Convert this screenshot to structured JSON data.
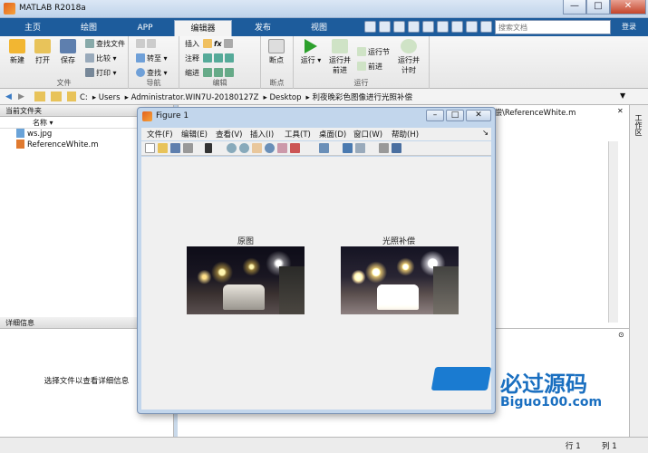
{
  "window": {
    "title": "MATLAB R2018a",
    "minimize": "—",
    "maximize": "□",
    "close": "✕"
  },
  "tabs": [
    "主页",
    "绘图",
    "APP",
    "编辑器",
    "发布",
    "视图"
  ],
  "active_tab": "编辑器",
  "search": {
    "placeholder": "搜索文档"
  },
  "login": "登录",
  "ribbon": {
    "file": {
      "label": "文件",
      "new": "新建",
      "open": "打开",
      "save": "保存",
      "find_files": "查找文件",
      "compare": "比较",
      "print": "打印"
    },
    "nav": {
      "label": "导航",
      "goto": "转至",
      "find": "查找"
    },
    "edit": {
      "label": "编辑",
      "insert": "插入",
      "comment": "注释",
      "indent": "缩进",
      "fx": "fx"
    },
    "breakpoints": {
      "label": "断点",
      "bp": "断点"
    },
    "run": {
      "label": "运行",
      "run": "运行",
      "run_advance": "运行并\n前进",
      "run_section": "运行节",
      "advance": "前进",
      "run_time": "运行并\n计时"
    }
  },
  "address": {
    "crumbs": [
      "C:",
      "Users",
      "Administrator.WIN7U-20180127Z",
      "Desktop",
      "利夜晚彩色图像进行光照补偿"
    ]
  },
  "current_folder": {
    "title": "当前文件夹",
    "name_col": "名称 ▾",
    "files": [
      "ws.jpg",
      "ReferenceWhite.m"
    ]
  },
  "details": {
    "title": "详细信息",
    "message": "选择文件以查看详细信息"
  },
  "editor": {
    "title": "补偿\\ReferenceWhite.m"
  },
  "workspace": {
    "label": "工作区"
  },
  "status": {
    "row_label": "行",
    "row": "1",
    "col_label": "列",
    "col": "1"
  },
  "figure": {
    "title": "Figure 1",
    "menu": [
      "文件(F)",
      "编辑(E)",
      "查看(V)",
      "插入(I)",
      "工具(T)",
      "桌面(D)",
      "窗口(W)",
      "帮助(H)"
    ],
    "left_title": "原图",
    "right_title": "光照补偿"
  },
  "watermark": {
    "name": "必过源码",
    "url": "Biguo100.com"
  }
}
